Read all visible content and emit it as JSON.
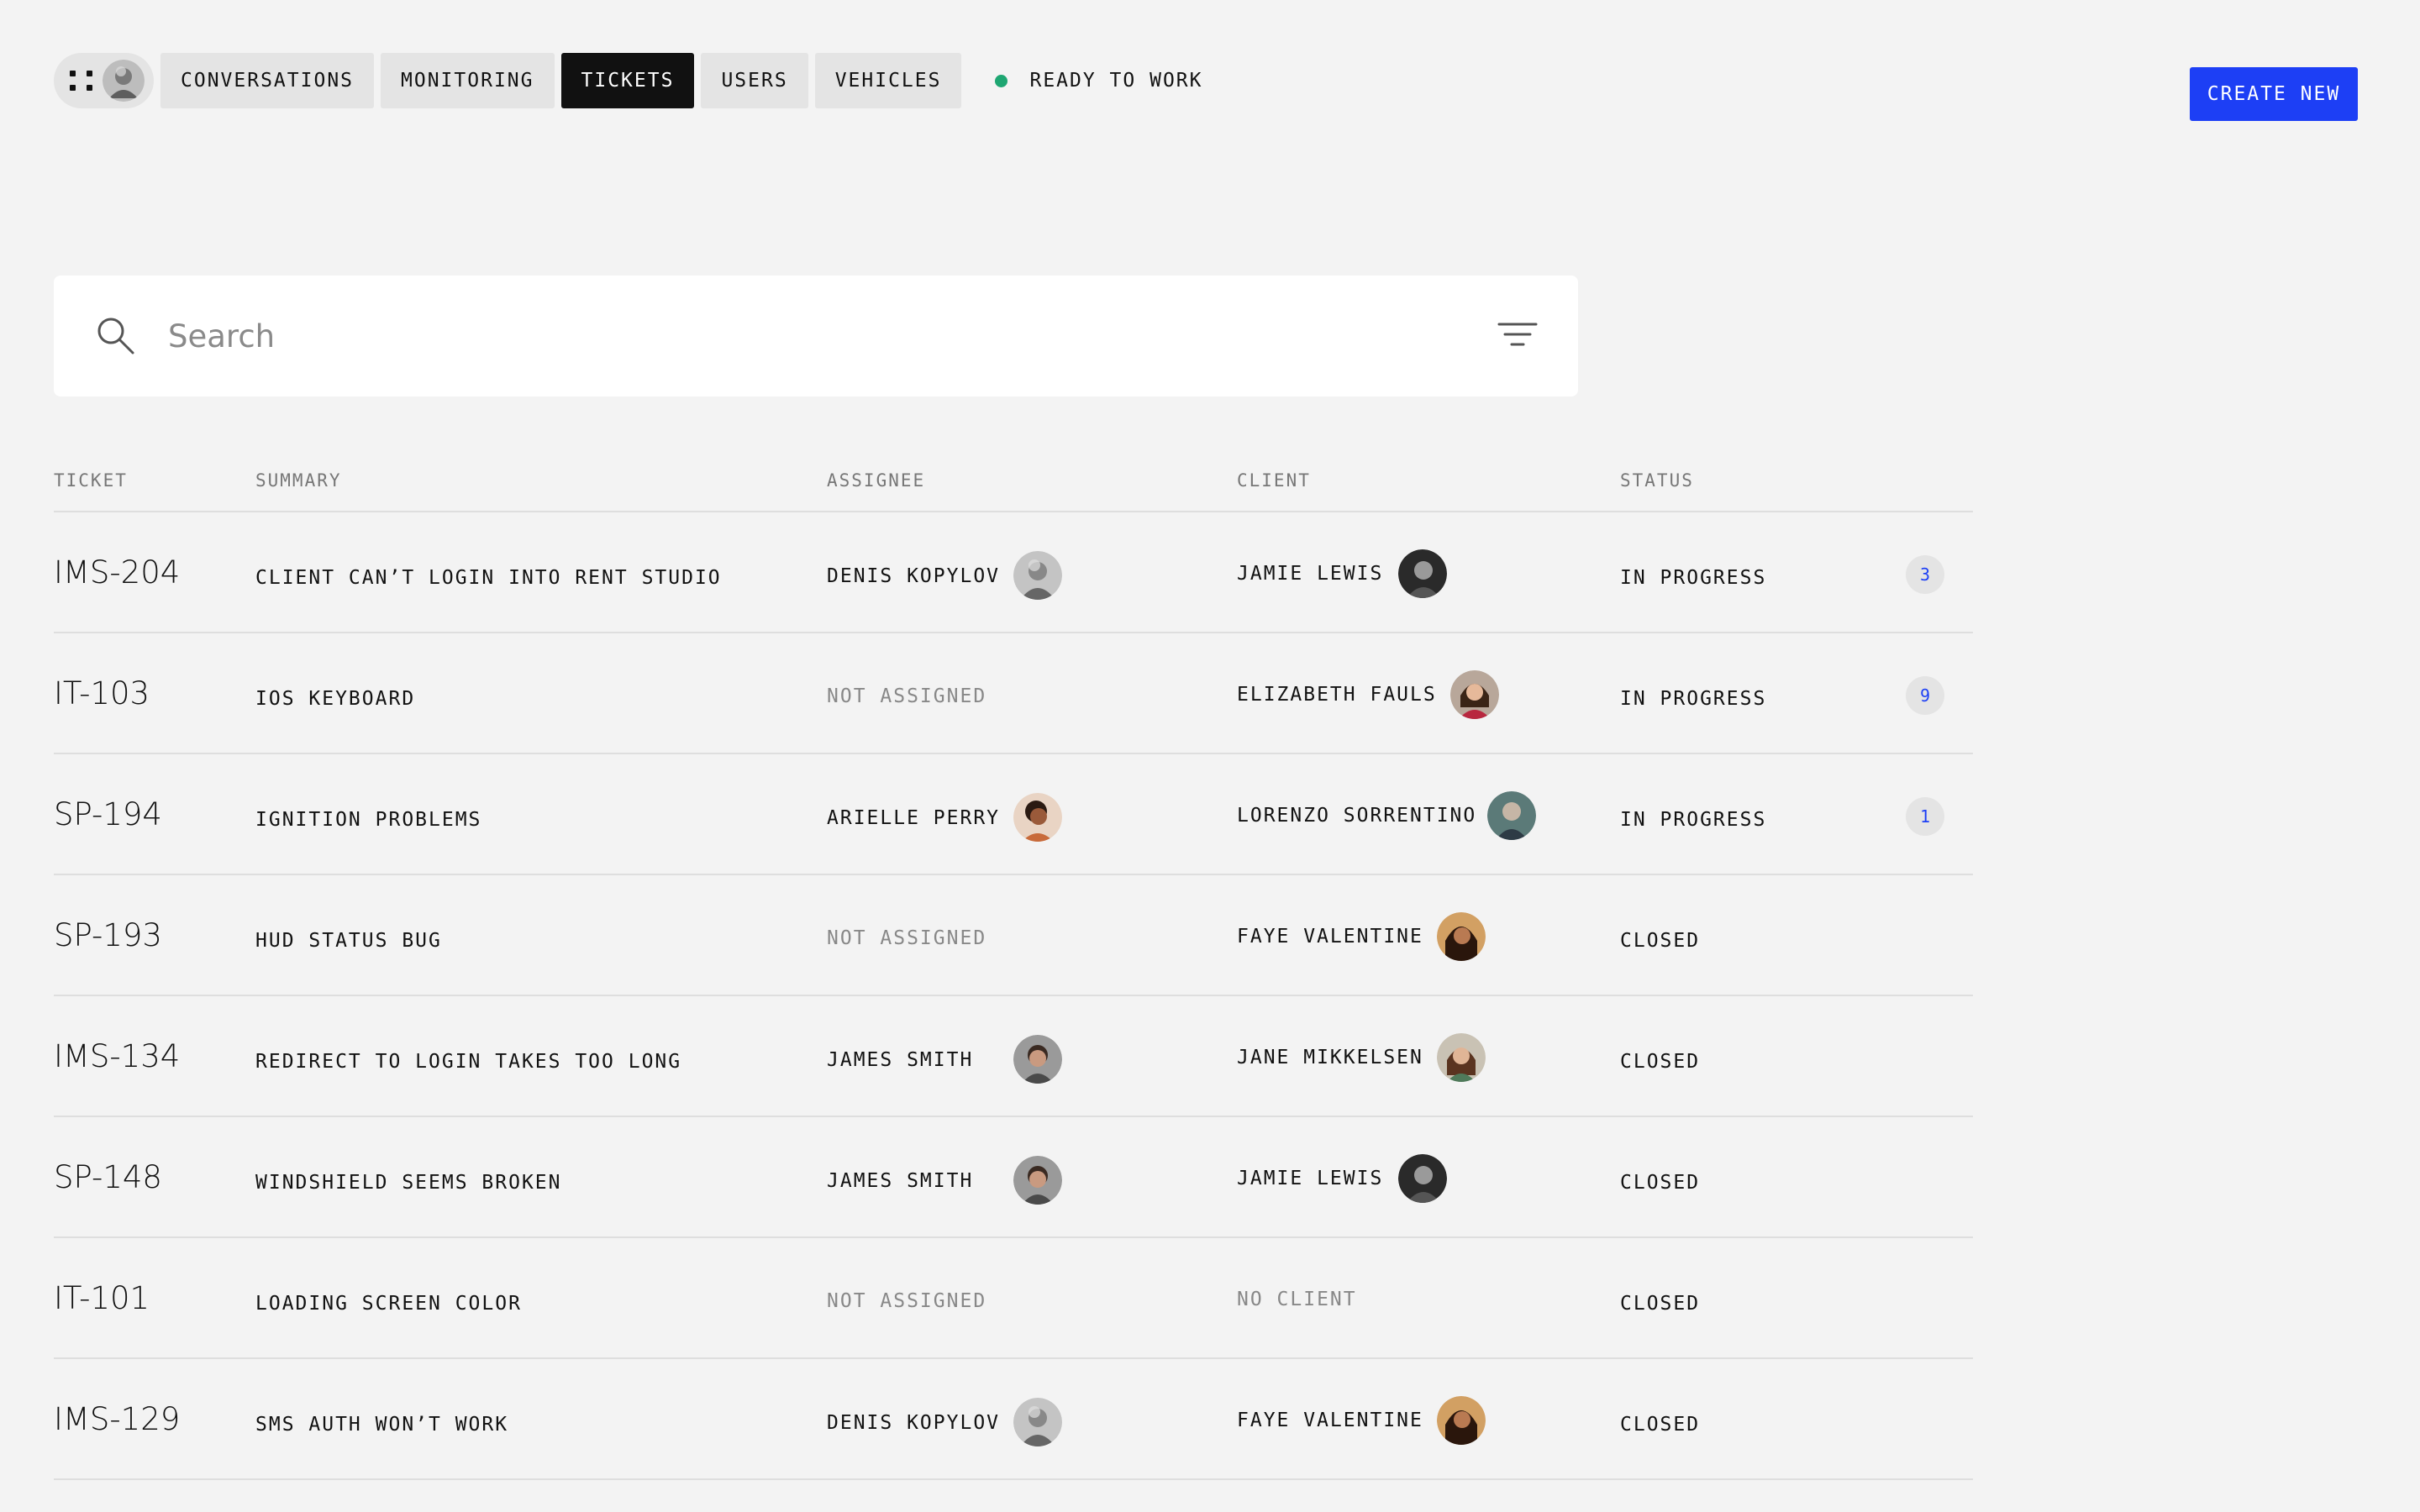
{
  "nav": {
    "tabs": [
      {
        "label": "CONVERSATIONS"
      },
      {
        "label": "MONITORING"
      },
      {
        "label": "TICKETS"
      },
      {
        "label": "USERS"
      },
      {
        "label": "VEHICLES"
      }
    ],
    "active_tab": "TICKETS",
    "status_text": "READY TO WORK",
    "status_color": "#1ea672",
    "create_label": "CREATE NEW",
    "accent_color": "#1d3ff5"
  },
  "search": {
    "placeholder": "Search",
    "value": ""
  },
  "table": {
    "headers": {
      "ticket": "TICKET",
      "summary": "SUMMARY",
      "assignee": "ASSIGNEE",
      "client": "CLIENT",
      "status": "STATUS"
    },
    "rows": [
      {
        "ticket": "IMS-204",
        "summary": "CLIENT CAN’T LOGIN INTO RENT STUDIO",
        "assignee": "DENIS KOPYLOV",
        "client": "JAMIE LEWIS",
        "status": "IN PROGRESS",
        "count": "3"
      },
      {
        "ticket": "IT-103",
        "summary": "IOS KEYBOARD",
        "assignee": "NOT ASSIGNED",
        "client": "ELIZABETH FAULS",
        "status": "IN PROGRESS",
        "count": "9"
      },
      {
        "ticket": "SP-194",
        "summary": "IGNITION PROBLEMS",
        "assignee": "ARIELLE PERRY",
        "client": "LORENZO SORRENTINO",
        "status": "IN PROGRESS",
        "count": "1"
      },
      {
        "ticket": "SP-193",
        "summary": "HUD STATUS BUG",
        "assignee": "NOT ASSIGNED",
        "client": "FAYE VALENTINE",
        "status": "CLOSED",
        "count": ""
      },
      {
        "ticket": "IMS-134",
        "summary": "REDIRECT TO LOGIN TAKES TOO LONG",
        "assignee": "JAMES SMITH",
        "client": "JANE MIKKELSEN",
        "status": "CLOSED",
        "count": ""
      },
      {
        "ticket": "SP-148",
        "summary": "WINDSHIELD SEEMS BROKEN",
        "assignee": "JAMES SMITH",
        "client": "JAMIE LEWIS",
        "status": "CLOSED",
        "count": ""
      },
      {
        "ticket": "IT-101",
        "summary": "LOADING SCREEN COLOR",
        "assignee": "NOT ASSIGNED",
        "client": "NO CLIENT",
        "status": "CLOSED",
        "count": ""
      },
      {
        "ticket": "IMS-129",
        "summary": "SMS AUTH WON’T WORK",
        "assignee": "DENIS KOPYLOV",
        "client": "FAYE VALENTINE",
        "status": "CLOSED",
        "count": ""
      }
    ]
  }
}
